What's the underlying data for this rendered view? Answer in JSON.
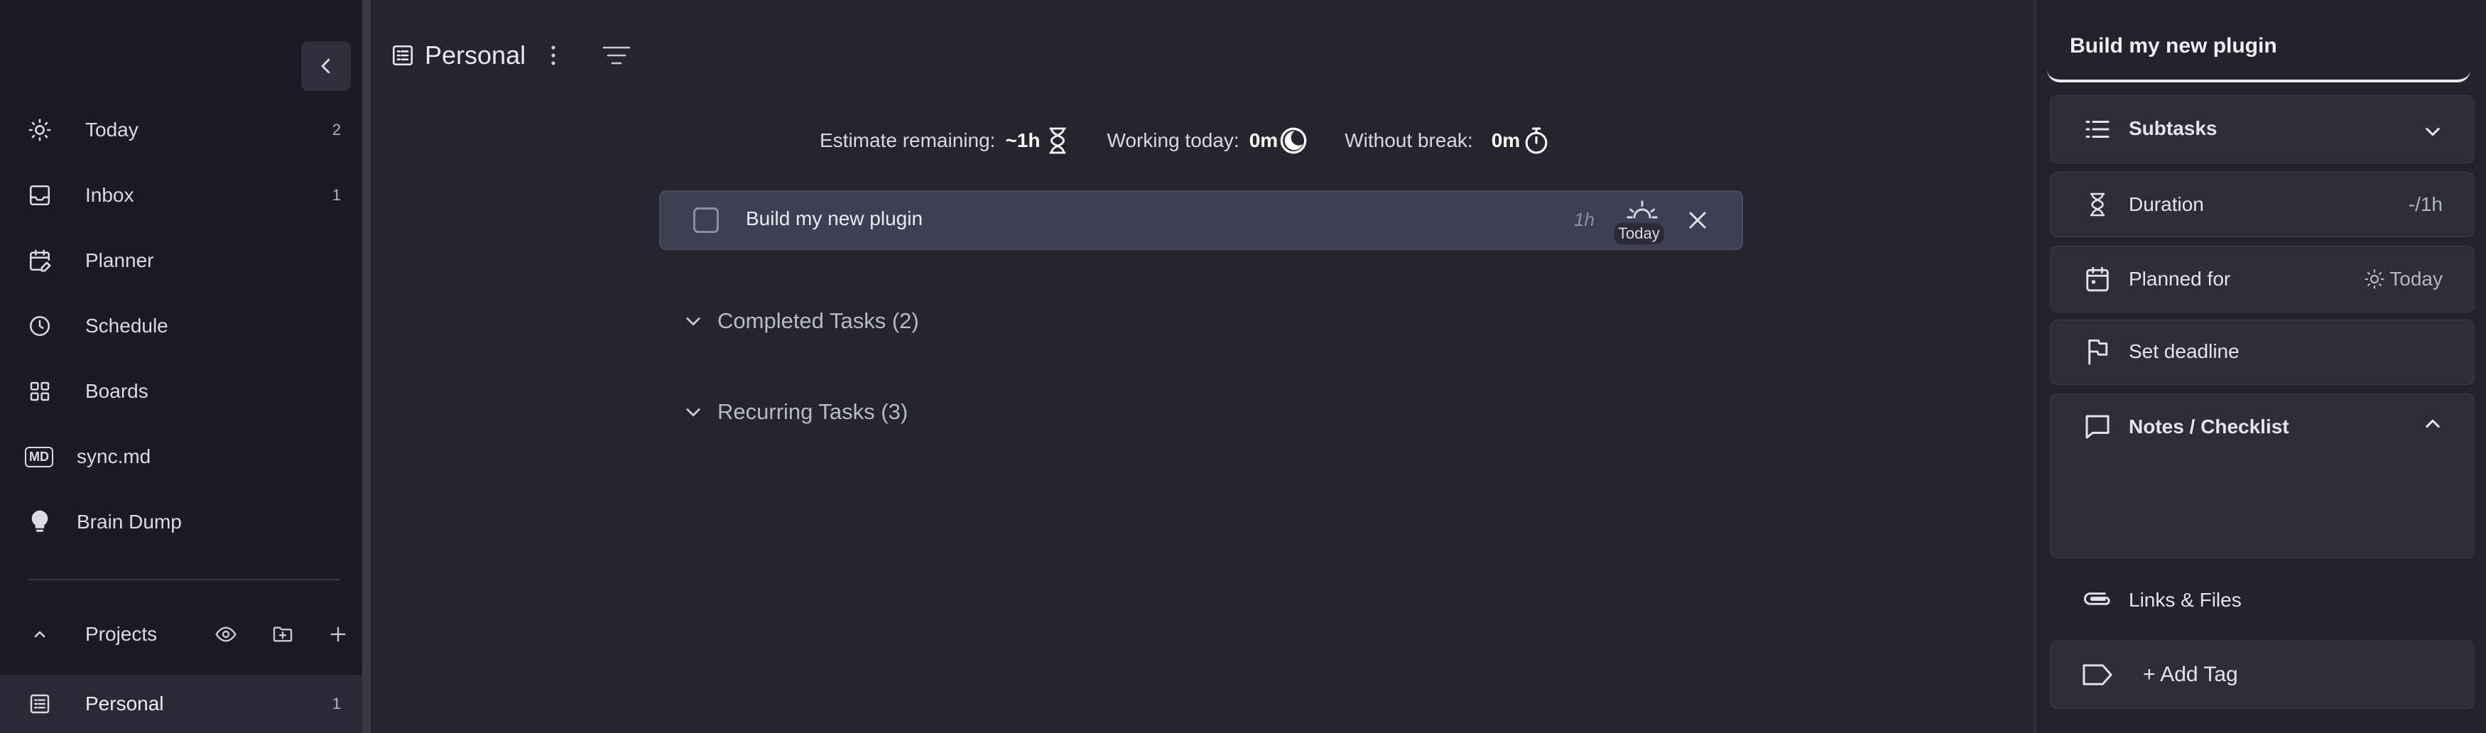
{
  "sidebar": {
    "nav": [
      {
        "label": "Today",
        "count": "2",
        "icon": "sun-icon"
      },
      {
        "label": "Inbox",
        "count": "1",
        "icon": "inbox-icon"
      },
      {
        "label": "Planner",
        "count": "",
        "icon": "calendar-edit-icon"
      },
      {
        "label": "Schedule",
        "count": "",
        "icon": "clock-icon"
      },
      {
        "label": "Boards",
        "count": "",
        "icon": "grid-icon"
      },
      {
        "label": "sync.md",
        "count": "",
        "icon": "markdown-icon"
      },
      {
        "label": "Brain Dump",
        "count": "",
        "icon": "lightbulb-icon"
      }
    ],
    "md_badge": "MD",
    "projects_label": "Projects",
    "projects": [
      {
        "label": "Personal",
        "count": "1"
      }
    ]
  },
  "main": {
    "title": "Personal",
    "stats": {
      "estimate_label": "Estimate remaining:",
      "estimate_value": "~1h",
      "working_label": "Working today:",
      "working_value": "0m",
      "break_label": "Without break:",
      "break_value": "0m"
    },
    "task": {
      "title": "Build my new plugin",
      "estimate": "1h",
      "planned_badge": "Today"
    },
    "groups": [
      {
        "label": "Completed Tasks (2)"
      },
      {
        "label": "Recurring Tasks (3)"
      }
    ]
  },
  "detail": {
    "title": "Build my new plugin",
    "subtasks_label": "Subtasks",
    "duration_label": "Duration",
    "duration_value": "-/1h",
    "planned_label": "Planned for",
    "planned_value": "Today",
    "deadline_label": "Set deadline",
    "notes_label": "Notes / Checklist",
    "links_label": "Links & Files",
    "tag_label": "+ Add Tag"
  },
  "colors": {
    "sidebar_bg": "#1b1b26",
    "main_bg": "#25252f",
    "task_bg": "#3f3f53",
    "panel_bg": "#23232b",
    "card_bg": "#2e2e36"
  }
}
